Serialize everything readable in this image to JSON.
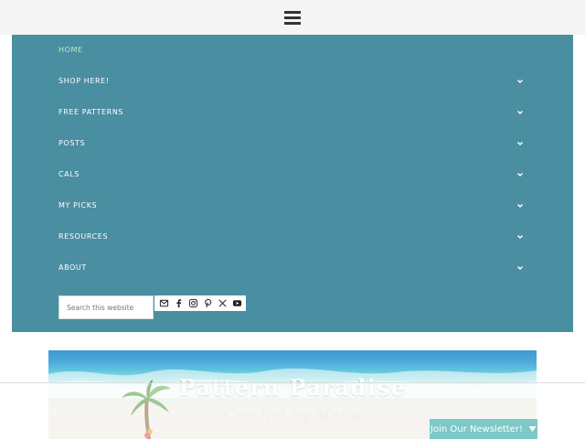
{
  "header": {
    "menu_icon": "hamburger-icon"
  },
  "menu": {
    "items": [
      {
        "label": "HOME",
        "active": true,
        "has_submenu": false
      },
      {
        "label": "SHOP HERE!",
        "active": false,
        "has_submenu": true
      },
      {
        "label": "FREE PATTERNS",
        "active": false,
        "has_submenu": true
      },
      {
        "label": "POSTS",
        "active": false,
        "has_submenu": true
      },
      {
        "label": "CALS",
        "active": false,
        "has_submenu": true
      },
      {
        "label": "MY PICKS",
        "active": false,
        "has_submenu": true
      },
      {
        "label": "RESOURCES",
        "active": false,
        "has_submenu": true
      },
      {
        "label": "ABOUT",
        "active": false,
        "has_submenu": true
      }
    ],
    "submenu_icon": "chevron-down-icon"
  },
  "search": {
    "placeholder": "Search this website",
    "value": ""
  },
  "social": [
    "email-icon",
    "facebook-icon",
    "instagram-icon",
    "pinterest-icon",
    "x-icon",
    "youtube-icon"
  ],
  "banner": {
    "title": "Pattern Paradise",
    "subtitle": "Crochet by Maria"
  },
  "newsletter": {
    "label": "Join Our Newsletter!",
    "icon": "triangle-down-icon"
  },
  "colors": {
    "menu_bg": "#4a8ea1",
    "active_item": "#b7eccc",
    "topbar_bg": "#f4f4f4",
    "newsletter_bg": "#7cc9c7"
  }
}
